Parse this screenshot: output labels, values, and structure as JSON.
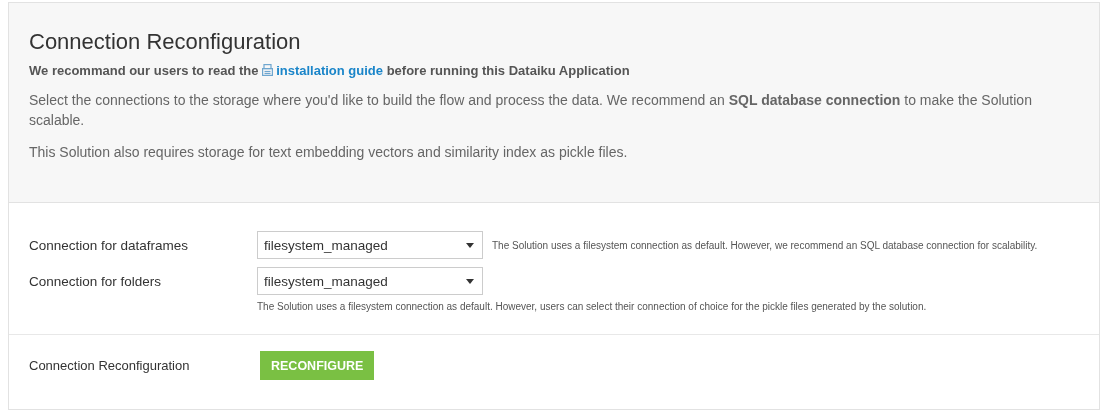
{
  "header": {
    "title": "Connection Reconfiguration",
    "notice": {
      "before": "We recommand our users to read the",
      "link": "installation guide",
      "after": "before running this Dataiku Application"
    },
    "paragraphs": [
      "Select the connections to the storage where you'd like to build the flow and process the data. We recommend an **SQL database connection** to make the Solution scalable.",
      "This Solution also requires storage for text embedding vectors and similarity index as pickle files."
    ]
  },
  "settings": [
    {
      "label": "Connection for dataframes",
      "value": "filesystem_managed",
      "hint": "The Solution uses a filesystem connection as default. However, we recommend an SQL database connection for scalability.",
      "kind": "inline"
    },
    {
      "label": "Connection for folders",
      "value": "filesystem_managed",
      "hint": "The Solution uses a filesystem connection as default. However, users can select their connection of choice for the pickle files generated by the solution.",
      "kind": "below"
    }
  ],
  "action": {
    "label": "Connection Reconfiguration",
    "button": "RECONFIGURE"
  }
}
